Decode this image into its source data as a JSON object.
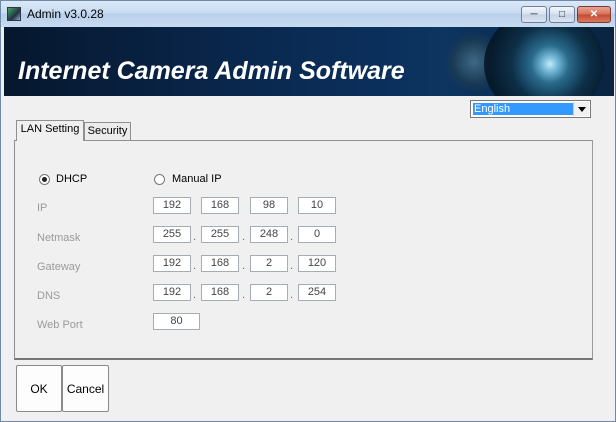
{
  "window": {
    "title": "Admin v3.0.28"
  },
  "banner": {
    "title": "Internet Camera Admin Software"
  },
  "language": {
    "selected": "English"
  },
  "tabs": [
    {
      "label": "LAN Setting",
      "active": true
    },
    {
      "label": "Security",
      "active": false
    }
  ],
  "network": {
    "mode_options": [
      {
        "label": "DHCP",
        "checked": true
      },
      {
        "label": "Manual IP",
        "checked": false
      }
    ],
    "fields": [
      {
        "label": "IP",
        "octets": [
          "192",
          "168",
          "98",
          "10"
        ]
      },
      {
        "label": "Netmask",
        "octets": [
          "255",
          "255",
          "248",
          "0"
        ]
      },
      {
        "label": "Gateway",
        "octets": [
          "192",
          "168",
          "2",
          "120"
        ]
      },
      {
        "label": "DNS",
        "octets": [
          "192",
          "168",
          "2",
          "254"
        ]
      }
    ],
    "web_port": {
      "label": "Web Port",
      "value": "80"
    }
  },
  "buttons": {
    "ok": "OK",
    "cancel": "Cancel"
  },
  "colors": {
    "banner_bg": "#0a2a52",
    "selection": "#3399ff"
  }
}
